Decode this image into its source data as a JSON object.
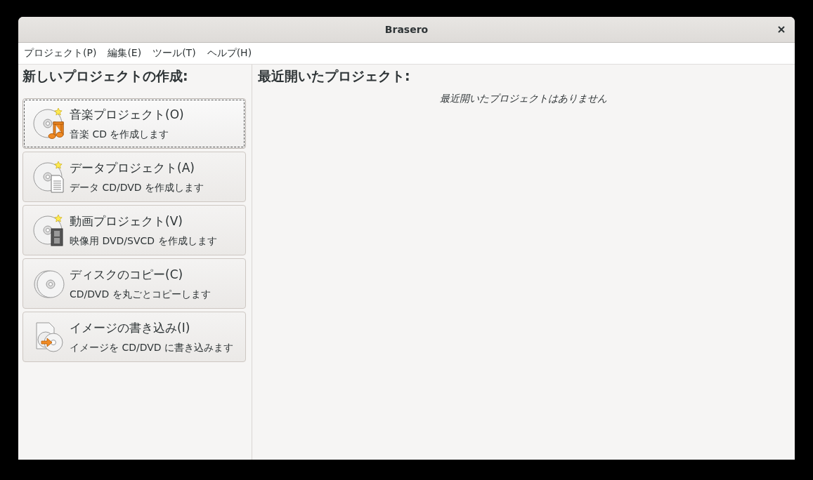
{
  "window": {
    "title": "Brasero"
  },
  "menu": [
    "プロジェクト(P)",
    "編集(E)",
    "ツール(T)",
    "ヘルプ(H)"
  ],
  "new_project": {
    "heading": "新しいプロジェクトの作成:",
    "items": [
      {
        "kind": "music",
        "title": "音楽プロジェクト(O)",
        "description": "音楽 CD を作成します",
        "selected": true
      },
      {
        "kind": "data",
        "title": "データプロジェクト(A)",
        "description": "データ CD/DVD を作成します",
        "selected": false
      },
      {
        "kind": "video",
        "title": "動画プロジェクト(V)",
        "description": "映像用 DVD/SVCD を作成します",
        "selected": false
      },
      {
        "kind": "copy",
        "title": "ディスクのコピー(C)",
        "description": "CD/DVD を丸ごとコピーします",
        "selected": false
      },
      {
        "kind": "image",
        "title": "イメージの書き込み(I)",
        "description": "イメージを CD/DVD に書き込みます",
        "selected": false
      }
    ]
  },
  "recent": {
    "heading": "最近開いたプロジェクト:",
    "empty_message": "最近開いたプロジェクトはありません"
  }
}
